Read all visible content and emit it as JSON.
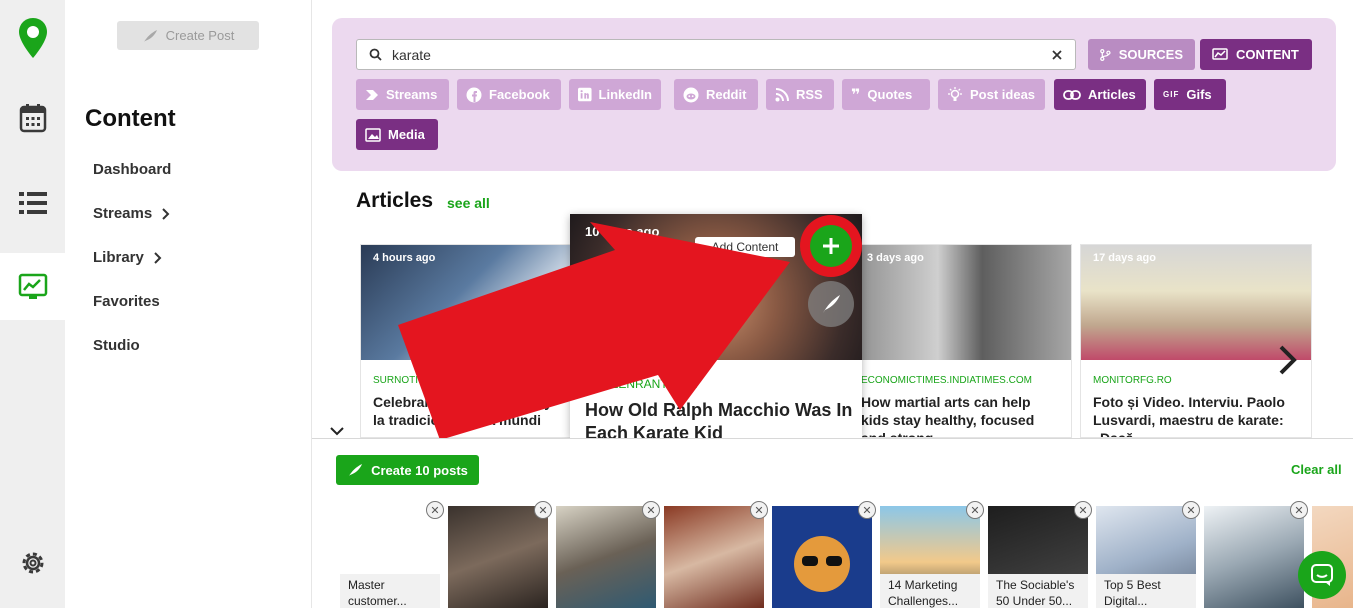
{
  "sidebar": {
    "create_post": "Create Post",
    "title": "Content",
    "items": [
      {
        "label": "Dashboard",
        "chevron": false
      },
      {
        "label": "Streams",
        "chevron": true
      },
      {
        "label": "Library",
        "chevron": true
      },
      {
        "label": "Favorites",
        "chevron": false
      },
      {
        "label": "Studio",
        "chevron": false
      }
    ]
  },
  "search": {
    "value": "karate"
  },
  "toggles": {
    "sources": "SOURCES",
    "content": "CONTENT"
  },
  "chips": [
    {
      "label": "Streams",
      "icon": "streams-icon",
      "active": false
    },
    {
      "label": "Facebook",
      "icon": "facebook-icon",
      "active": false
    },
    {
      "label": "LinkedIn",
      "icon": "linkedin-icon",
      "active": false
    },
    {
      "label": "Reddit",
      "icon": "reddit-icon",
      "active": false
    },
    {
      "label": "RSS",
      "icon": "rss-icon",
      "active": false
    },
    {
      "label": "Quotes",
      "icon": "quote-icon",
      "active": false
    },
    {
      "label": "Post ideas",
      "icon": "lightbulb-icon",
      "active": false
    },
    {
      "label": "Articles",
      "icon": "link-icon",
      "active": true
    },
    {
      "label": "Gifs",
      "icon": "gif-icon",
      "active": true
    },
    {
      "label": "Media",
      "icon": "image-icon",
      "active": true
    }
  ],
  "articles": {
    "title": "Articles",
    "see_all": "see all",
    "add_content": "Add Content",
    "cards": [
      {
        "age": "4 hours ago",
        "source": "SURNOTI",
        "title": "Celebrando la excelencia y la tradición: El Día mundi"
      },
      {
        "age": "10 days ago",
        "source": "SCREENRANT.COM",
        "title": "How Old Ralph Macchio Was In Each Karate Kid"
      },
      {
        "age": "3 days ago",
        "source": "ECONOMICTIMES.INDIATIMES.COM",
        "title": "How martial arts can help kids stay healthy, focused and strong"
      },
      {
        "age": "17 days ago",
        "source": "MONITORFG.RO",
        "title": "Foto și Video. Interviu. Paolo Lusvardi, maestru de karate: „Dacă"
      }
    ]
  },
  "tray": {
    "create_button": "Create 10 posts",
    "clear_all": "Clear all",
    "thumbs": [
      {
        "caption": "Master customer..."
      },
      {
        "caption": ""
      },
      {
        "caption": ""
      },
      {
        "caption": ""
      },
      {
        "caption": ""
      },
      {
        "caption": "14 Marketing Challenges..."
      },
      {
        "caption": "The Sociable's 50 Under 50..."
      },
      {
        "caption": "Top 5 Best Digital..."
      },
      {
        "caption": ""
      }
    ]
  },
  "colors": {
    "brand_green": "#1aa51a",
    "purple_active": "#7a2f83",
    "purple_light": "#cfa7d6",
    "panel": "#ecd9ef",
    "callout_red": "#e4151f"
  }
}
